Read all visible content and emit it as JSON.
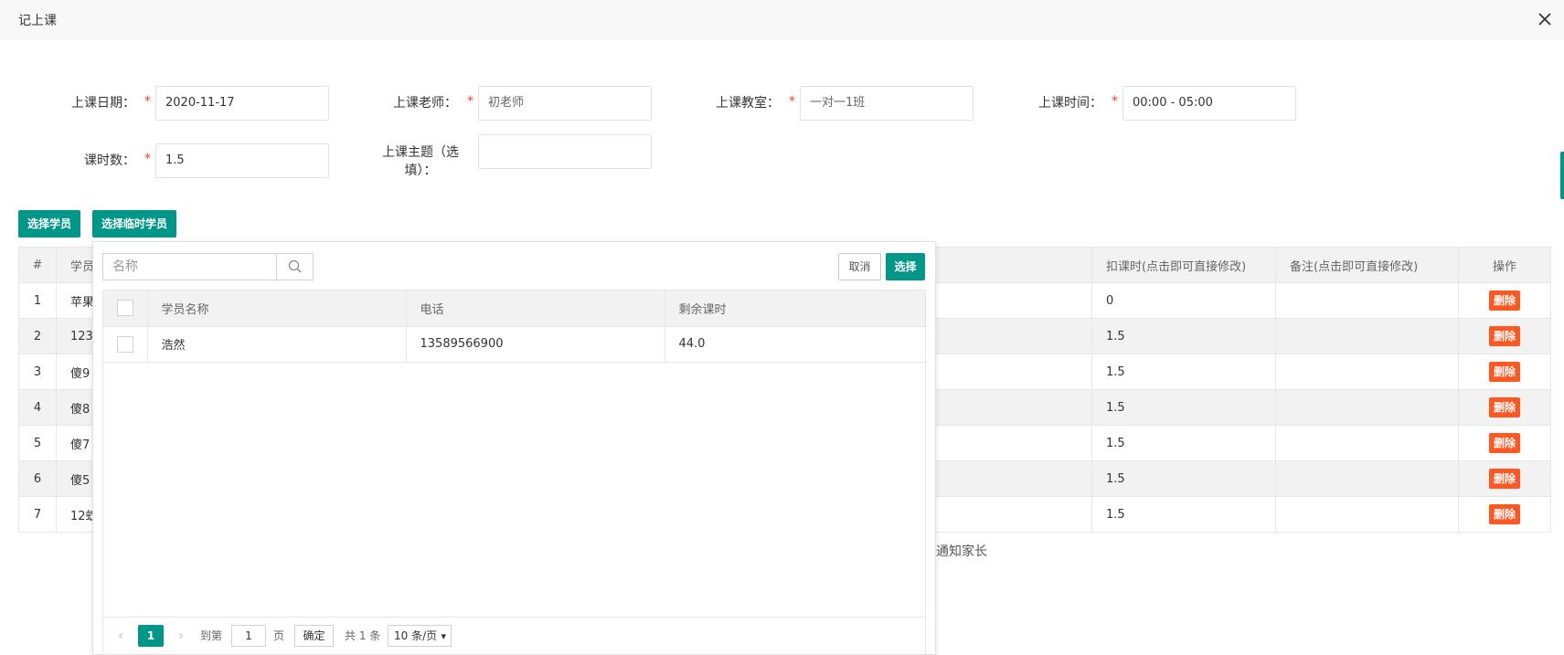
{
  "window": {
    "title": "记上课"
  },
  "form": {
    "date_label": "上课日期：",
    "date_value": "2020-11-17",
    "teacher_label": "上课老师：",
    "teacher_value": "初老师",
    "room_label": "上课教室：",
    "room_value": "一对一1班",
    "time_label": "上课时间：",
    "time_value": "00:00 - 05:00",
    "hours_label": "课时数：",
    "hours_value": "1.5",
    "topic_label_line1": "上课主题（选",
    "topic_label_line2": "填）：",
    "topic_value": "",
    "required_mark": "*"
  },
  "buttons": {
    "select_student": "选择学员",
    "select_temp_student": "选择临时学员"
  },
  "main_table": {
    "headers": [
      "#",
      "学员",
      "扣课时(点击即可直接修改)",
      "备注(点击即可直接修改)",
      "操作"
    ],
    "rows": [
      {
        "idx": "1",
        "name": "苹果",
        "deduct": "0",
        "note": "",
        "action": "删除"
      },
      {
        "idx": "2",
        "name": "1233",
        "deduct": "1.5",
        "note": "",
        "action": "删除"
      },
      {
        "idx": "3",
        "name": "傻9",
        "deduct": "1.5",
        "note": "",
        "action": "删除"
      },
      {
        "idx": "4",
        "name": "傻8",
        "deduct": "1.5",
        "note": "",
        "action": "删除"
      },
      {
        "idx": "5",
        "name": "傻7",
        "deduct": "1.5",
        "note": "",
        "action": "删除"
      },
      {
        "idx": "6",
        "name": "傻5",
        "deduct": "1.5",
        "note": "",
        "action": "删除"
      },
      {
        "idx": "7",
        "name": "12蚁",
        "deduct": "1.5",
        "note": "",
        "action": "删除"
      }
    ]
  },
  "notify_text": "通知家长",
  "popup": {
    "search_placeholder": "名称",
    "cancel_label": "取消",
    "select_label": "选择",
    "headers": [
      "学员名称",
      "电话",
      "剩余课时"
    ],
    "rows": [
      {
        "name": "浩然",
        "phone": "13589566900",
        "remaining": "44.0"
      }
    ],
    "pager": {
      "current_page": "1",
      "goto_label": "到第",
      "goto_value": "1",
      "page_unit": "页",
      "confirm_label": "确定",
      "total": "共 1 条",
      "page_size": "10 条/页"
    }
  },
  "colors": {
    "primary": "#009688",
    "danger": "#ff5722",
    "required": "#ff3b30"
  }
}
